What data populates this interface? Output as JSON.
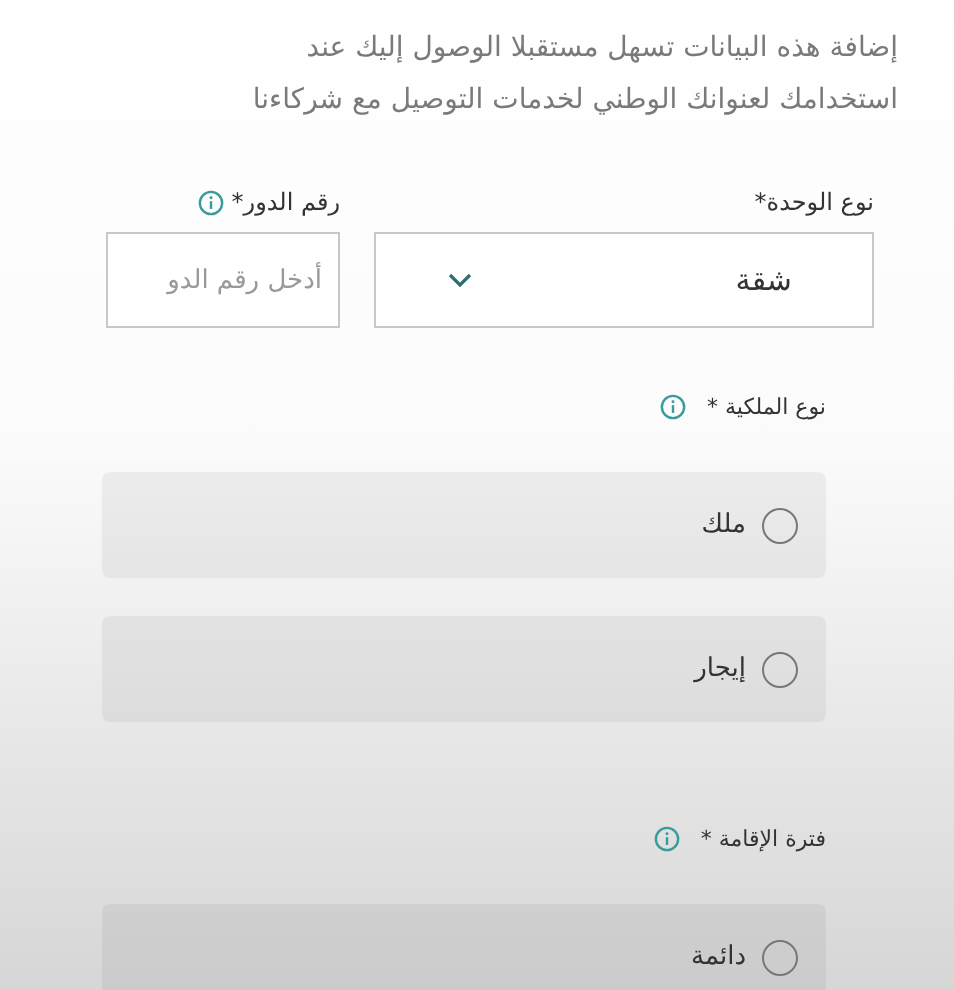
{
  "intro_lines": [
    "إضافة هذه البيانات تسهل مستقبلا الوصول إليك عند",
    "استخدامك لعنوانك الوطني لخدمات التوصيل مع شركاءنا"
  ],
  "fields": [
    {
      "kind": "select",
      "label": "نوع الوحدة*",
      "value": "شقة"
    },
    {
      "kind": "input",
      "label": "رقم الدور*",
      "placeholder": "أدخل رقم الدو",
      "info": true
    }
  ],
  "groups": [
    {
      "label": "نوع الملكية *",
      "info": true,
      "options": [
        {
          "label": "ملك",
          "selected": false
        },
        {
          "label": "إيجار",
          "selected": false
        }
      ]
    },
    {
      "label": "فترة الإقامة *",
      "info": true,
      "options": [
        {
          "label": "دائمة",
          "selected": false
        }
      ]
    }
  ]
}
